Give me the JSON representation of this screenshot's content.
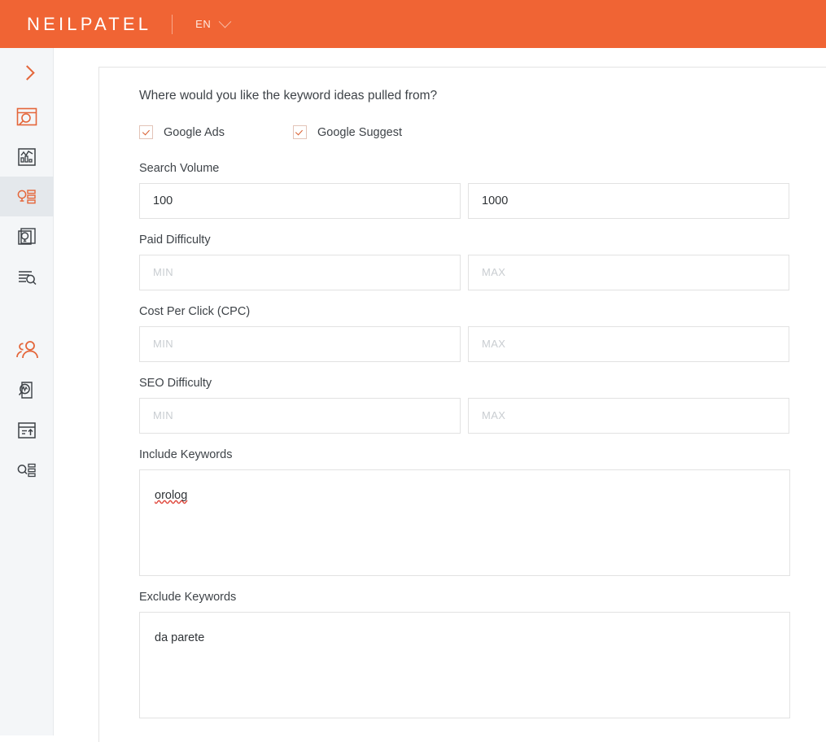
{
  "header": {
    "logo": "NEILPATEL",
    "language": "EN",
    "chevron_icon": "chevron-down-icon",
    "bg_color": "#f06434"
  },
  "sidebar": {
    "bg_color": "#f4f6f8",
    "active_bg_color": "#e4e8ec",
    "accent_color": "#e4663a",
    "expand_icon": "chevron-right-icon",
    "items": [
      {
        "icon": "site-audit-icon",
        "active": false,
        "accent": true
      },
      {
        "icon": "traffic-analytics-icon",
        "active": false,
        "accent": false
      },
      {
        "icon": "keyword-ideas-icon",
        "active": true,
        "accent": true
      },
      {
        "icon": "content-ideas-icon",
        "active": false,
        "accent": false
      },
      {
        "icon": "keyword-research-list-icon",
        "active": false,
        "accent": false
      },
      {
        "icon": "competitors-icon",
        "active": false,
        "accent": true
      },
      {
        "icon": "page-analytics-icon",
        "active": false,
        "accent": false
      },
      {
        "icon": "backlinks-export-icon",
        "active": false,
        "accent": false
      },
      {
        "icon": "keyword-list-search-icon",
        "active": false,
        "accent": false
      }
    ]
  },
  "form": {
    "question": "Where would you like the keyword ideas pulled from?",
    "sources": [
      {
        "label": "Google Ads",
        "checked": true
      },
      {
        "label": "Google Suggest",
        "checked": true
      }
    ],
    "fields": [
      {
        "label": "Search Volume",
        "min_value": "100",
        "max_value": "1000",
        "min_placeholder": "MIN",
        "max_placeholder": "MAX"
      },
      {
        "label": "Paid Difficulty",
        "min_value": "",
        "max_value": "",
        "min_placeholder": "MIN",
        "max_placeholder": "MAX"
      },
      {
        "label": "Cost Per Click (CPC)",
        "min_value": "",
        "max_value": "",
        "min_placeholder": "MIN",
        "max_placeholder": "MAX"
      },
      {
        "label": "SEO Difficulty",
        "min_value": "",
        "max_value": "",
        "min_placeholder": "MIN",
        "max_placeholder": "MAX"
      }
    ],
    "include_keywords": {
      "label": "Include Keywords",
      "value": "orolog",
      "misspelled": true
    },
    "exclude_keywords": {
      "label": "Exclude Keywords",
      "value": "da parete",
      "misspelled": false
    }
  }
}
